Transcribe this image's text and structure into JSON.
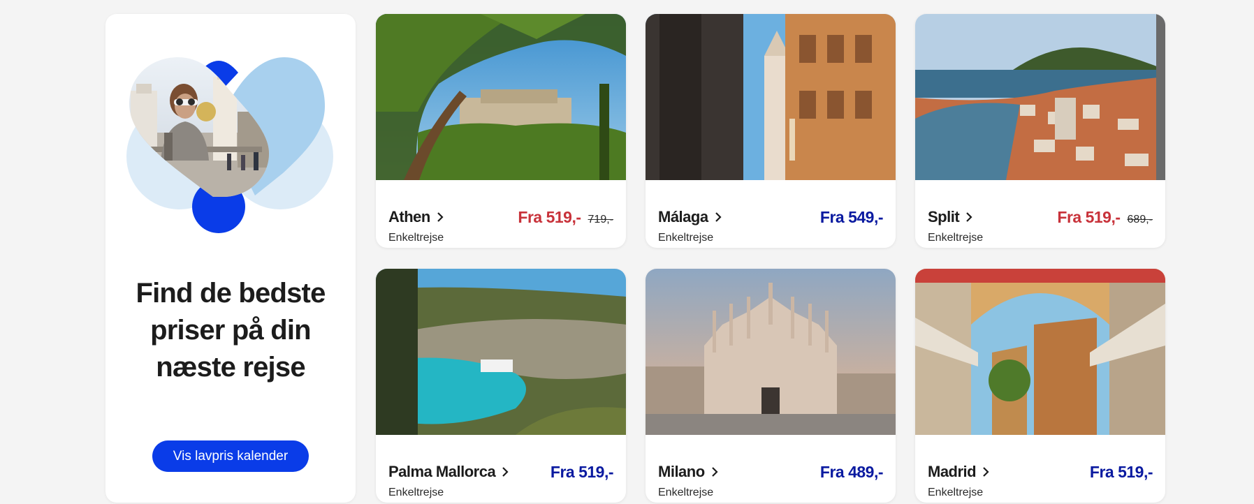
{
  "promo": {
    "title": "Find de bedste priser på din næste rejse",
    "button_label": "Vis lavpris kalender",
    "accent_color": "#0a3ce8",
    "art_color_light": "#dcebf7",
    "art_color_mid": "#a8d0ee"
  },
  "price_colors": {
    "sale": "#c8323a",
    "normal": "#0a1aa0"
  },
  "destinations": [
    {
      "name": "Athen",
      "trip_type": "Enkeltrejse",
      "price": "Fra 519,-",
      "old_price": "719,-",
      "on_sale": true,
      "image": "acropolis-photo"
    },
    {
      "name": "Málaga",
      "trip_type": "Enkeltrejse",
      "price": "Fra 549,-",
      "old_price": "",
      "on_sale": false,
      "image": "malaga-street-photo"
    },
    {
      "name": "Split",
      "trip_type": "Enkeltrejse",
      "price": "Fra 519,-",
      "old_price": "689,-",
      "on_sale": true,
      "image": "split-harbour-photo"
    },
    {
      "name": "Palma Mallorca",
      "trip_type": "Enkeltrejse",
      "price": "Fra 519,-",
      "old_price": "",
      "on_sale": false,
      "image": "mallorca-cove-photo"
    },
    {
      "name": "Milano",
      "trip_type": "Enkeltrejse",
      "price": "Fra 489,-",
      "old_price": "",
      "on_sale": false,
      "image": "milan-duomo-photo"
    },
    {
      "name": "Madrid",
      "trip_type": "Enkeltrejse",
      "price": "Fra 519,-",
      "old_price": "",
      "on_sale": false,
      "image": "madrid-plaza-photo"
    }
  ]
}
